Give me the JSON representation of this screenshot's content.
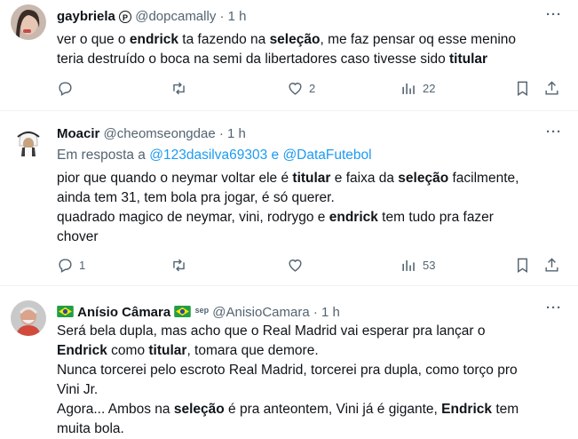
{
  "tweets": [
    {
      "name": "gaybriela",
      "badge": "P",
      "handle": "@dopcamally",
      "dot": "·",
      "time": "1 h",
      "lines": [
        [
          {
            "t": "ver o que o "
          },
          {
            "t": "endrick",
            "b": true
          },
          {
            "t": " ta fazendo na "
          },
          {
            "t": "seleção",
            "b": true
          },
          {
            "t": ", me faz pensar oq esse menino"
          }
        ],
        [
          {
            "t": "teria destruído o boca na semi da libertadores caso tivesse sido "
          },
          {
            "t": "titular",
            "b": true
          }
        ]
      ],
      "reply": "",
      "like": "2",
      "retweet": "",
      "views": "22"
    },
    {
      "name": "Moacir",
      "handle": "@cheomseongdae",
      "dot": "·",
      "time": "1 h",
      "reply_prefix": "Em resposta a ",
      "reply_to_1": "@123dasilva69303",
      "reply_and": " e ",
      "reply_to_2": "@DataFutebol",
      "lines": [
        [
          {
            "t": "pior que quando o neymar voltar ele é "
          },
          {
            "t": "titular",
            "b": true
          },
          {
            "t": " e faixa da "
          },
          {
            "t": "seleção",
            "b": true
          },
          {
            "t": " facilmente,"
          }
        ],
        [
          {
            "t": "ainda tem 31, tem bola pra jogar, é só querer."
          }
        ],
        [
          {
            "t": "quadrado magico de neymar, vini, rodrygo e "
          },
          {
            "t": "endrick",
            "b": true
          },
          {
            "t": " tem tudo pra fazer"
          }
        ],
        [
          {
            "t": "chover"
          }
        ]
      ],
      "reply": "1",
      "like": "",
      "retweet": "",
      "views": "53"
    },
    {
      "name": "Anísio Câmara",
      "sep": "sep",
      "handle": "@AnisioCamara",
      "dot": "·",
      "time": "1 h",
      "lines": [
        [
          {
            "t": "Será bela dupla, mas acho que o Real Madrid vai esperar pra lançar o"
          }
        ],
        [
          {
            "t": "Endrick",
            "b": true
          },
          {
            "t": " como "
          },
          {
            "t": "titular",
            "b": true
          },
          {
            "t": ", tomara que demore."
          }
        ],
        [
          {
            "t": "Nunca torcerei pelo escroto Real Madrid, torcerei pra dupla, como torço pro"
          }
        ],
        [
          {
            "t": "Vini Jr."
          }
        ],
        [
          {
            "t": "Agora... Ambos na "
          },
          {
            "t": "seleção",
            "b": true
          },
          {
            "t": " é pra anteontem, Vini já é gigante, "
          },
          {
            "t": "Endrick",
            "b": true
          },
          {
            "t": " tem"
          }
        ],
        [
          {
            "t": "muita bola."
          }
        ]
      ]
    }
  ],
  "more_label": "···",
  "colors": {
    "text": "#0f1419",
    "muted": "#536471",
    "link": "#1d9bf0",
    "border": "#eff3f4"
  },
  "icons": [
    "reply-icon",
    "retweet-icon",
    "like-icon",
    "views-icon",
    "bookmark-icon",
    "share-icon",
    "more-icon",
    "brazil-flag-icon"
  ]
}
